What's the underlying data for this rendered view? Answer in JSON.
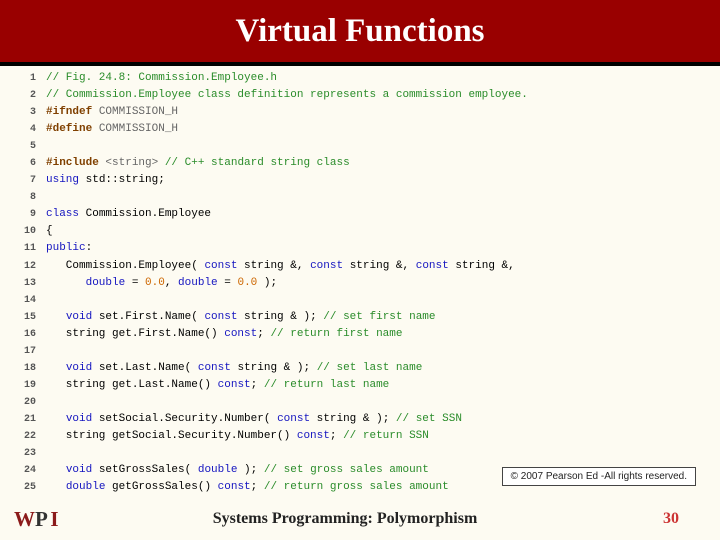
{
  "title": "Virtual Functions",
  "code_lines": [
    [
      {
        "cls": "c-comment",
        "t": "// Fig. 24.8: Commission.Employee.h"
      }
    ],
    [
      {
        "cls": "c-comment",
        "t": "// Commission.Employee class definition represents a commission employee."
      }
    ],
    [
      {
        "cls": "c-pp",
        "t": "#ifndef "
      },
      {
        "cls": "c-str",
        "t": "COMMISSION_H"
      }
    ],
    [
      {
        "cls": "c-pp",
        "t": "#define "
      },
      {
        "cls": "c-str",
        "t": "COMMISSION_H"
      }
    ],
    [],
    [
      {
        "cls": "c-pp",
        "t": "#include "
      },
      {
        "cls": "c-str",
        "t": "<string>"
      },
      {
        "cls": "c-comment",
        "t": " // C++ standard string class"
      }
    ],
    [
      {
        "cls": "c-kw",
        "t": "using"
      },
      {
        "cls": "c-id",
        "t": " std::string;"
      }
    ],
    [],
    [
      {
        "cls": "c-kw",
        "t": "class"
      },
      {
        "cls": "c-id",
        "t": " Commission.Employee"
      }
    ],
    [
      {
        "cls": "c-id",
        "t": "{"
      }
    ],
    [
      {
        "cls": "c-kw",
        "t": "public"
      },
      {
        "cls": "c-id",
        "t": ":"
      }
    ],
    [
      {
        "cls": "c-id",
        "t": "   Commission.Employee( "
      },
      {
        "cls": "c-kw",
        "t": "const"
      },
      {
        "cls": "c-id",
        "t": " string &, "
      },
      {
        "cls": "c-kw",
        "t": "const"
      },
      {
        "cls": "c-id",
        "t": " string &, "
      },
      {
        "cls": "c-kw",
        "t": "const"
      },
      {
        "cls": "c-id",
        "t": " string &,"
      }
    ],
    [
      {
        "cls": "c-id",
        "t": "      "
      },
      {
        "cls": "c-kw",
        "t": "double"
      },
      {
        "cls": "c-id",
        "t": " = "
      },
      {
        "cls": "c-num",
        "t": "0.0"
      },
      {
        "cls": "c-id",
        "t": ", "
      },
      {
        "cls": "c-kw",
        "t": "double"
      },
      {
        "cls": "c-id",
        "t": " = "
      },
      {
        "cls": "c-num",
        "t": "0.0"
      },
      {
        "cls": "c-id",
        "t": " );"
      }
    ],
    [],
    [
      {
        "cls": "c-id",
        "t": "   "
      },
      {
        "cls": "c-kw",
        "t": "void"
      },
      {
        "cls": "c-id",
        "t": " set.First.Name( "
      },
      {
        "cls": "c-kw",
        "t": "const"
      },
      {
        "cls": "c-id",
        "t": " string & ); "
      },
      {
        "cls": "c-comment",
        "t": "// set first name"
      }
    ],
    [
      {
        "cls": "c-id",
        "t": "   string get.First.Name() "
      },
      {
        "cls": "c-kw",
        "t": "const"
      },
      {
        "cls": "c-id",
        "t": "; "
      },
      {
        "cls": "c-comment",
        "t": "// return first name"
      }
    ],
    [],
    [
      {
        "cls": "c-id",
        "t": "   "
      },
      {
        "cls": "c-kw",
        "t": "void"
      },
      {
        "cls": "c-id",
        "t": " set.Last.Name( "
      },
      {
        "cls": "c-kw",
        "t": "const"
      },
      {
        "cls": "c-id",
        "t": " string & ); "
      },
      {
        "cls": "c-comment",
        "t": "// set last name"
      }
    ],
    [
      {
        "cls": "c-id",
        "t": "   string get.Last.Name() "
      },
      {
        "cls": "c-kw",
        "t": "const"
      },
      {
        "cls": "c-id",
        "t": "; "
      },
      {
        "cls": "c-comment",
        "t": "// return last name"
      }
    ],
    [],
    [
      {
        "cls": "c-id",
        "t": "   "
      },
      {
        "cls": "c-kw",
        "t": "void"
      },
      {
        "cls": "c-id",
        "t": " setSocial.Security.Number( "
      },
      {
        "cls": "c-kw",
        "t": "const"
      },
      {
        "cls": "c-id",
        "t": " string & ); "
      },
      {
        "cls": "c-comment",
        "t": "// set SSN"
      }
    ],
    [
      {
        "cls": "c-id",
        "t": "   string getSocial.Security.Number() "
      },
      {
        "cls": "c-kw",
        "t": "const"
      },
      {
        "cls": "c-id",
        "t": "; "
      },
      {
        "cls": "c-comment",
        "t": "// return SSN"
      }
    ],
    [],
    [
      {
        "cls": "c-id",
        "t": "   "
      },
      {
        "cls": "c-kw",
        "t": "void"
      },
      {
        "cls": "c-id",
        "t": " setGrossSales( "
      },
      {
        "cls": "c-kw",
        "t": "double"
      },
      {
        "cls": "c-id",
        "t": " ); "
      },
      {
        "cls": "c-comment",
        "t": "// set gross sales amount"
      }
    ],
    [
      {
        "cls": "c-id",
        "t": "   "
      },
      {
        "cls": "c-kw",
        "t": "double"
      },
      {
        "cls": "c-id",
        "t": " getGrossSales() "
      },
      {
        "cls": "c-kw",
        "t": "const"
      },
      {
        "cls": "c-id",
        "t": "; "
      },
      {
        "cls": "c-comment",
        "t": "// return gross sales amount"
      }
    ]
  ],
  "copyright": "© 2007 Pearson Ed -All rights reserved.",
  "footer_caption": "Systems Programming: Polymorphism",
  "page_number": "30",
  "logo_text": "WPI"
}
